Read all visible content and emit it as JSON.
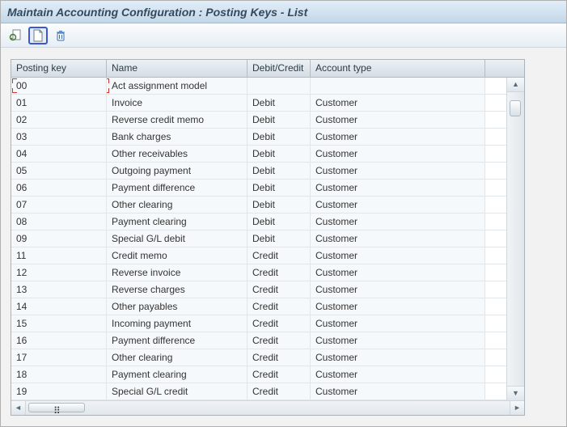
{
  "title": "Maintain Accounting Configuration : Posting Keys - List",
  "columns": {
    "key": "Posting key",
    "name": "Name",
    "dc": "Debit/Credit",
    "at": "Account type"
  },
  "rows": [
    {
      "key": "00",
      "name": "Act assignment model",
      "dc": "",
      "at": ""
    },
    {
      "key": "01",
      "name": "Invoice",
      "dc": "Debit",
      "at": "Customer"
    },
    {
      "key": "02",
      "name": "Reverse credit memo",
      "dc": "Debit",
      "at": "Customer"
    },
    {
      "key": "03",
      "name": "Bank charges",
      "dc": "Debit",
      "at": "Customer"
    },
    {
      "key": "04",
      "name": "Other receivables",
      "dc": "Debit",
      "at": "Customer"
    },
    {
      "key": "05",
      "name": "Outgoing payment",
      "dc": "Debit",
      "at": "Customer"
    },
    {
      "key": "06",
      "name": "Payment difference",
      "dc": "Debit",
      "at": "Customer"
    },
    {
      "key": "07",
      "name": "Other clearing",
      "dc": "Debit",
      "at": "Customer"
    },
    {
      "key": "08",
      "name": "Payment clearing",
      "dc": "Debit",
      "at": "Customer"
    },
    {
      "key": "09",
      "name": "Special G/L debit",
      "dc": "Debit",
      "at": "Customer"
    },
    {
      "key": "11",
      "name": "Credit memo",
      "dc": "Credit",
      "at": "Customer"
    },
    {
      "key": "12",
      "name": "Reverse invoice",
      "dc": "Credit",
      "at": "Customer"
    },
    {
      "key": "13",
      "name": "Reverse charges",
      "dc": "Credit",
      "at": "Customer"
    },
    {
      "key": "14",
      "name": "Other payables",
      "dc": "Credit",
      "at": "Customer"
    },
    {
      "key": "15",
      "name": "Incoming payment",
      "dc": "Credit",
      "at": "Customer"
    },
    {
      "key": "16",
      "name": "Payment difference",
      "dc": "Credit",
      "at": "Customer"
    },
    {
      "key": "17",
      "name": "Other clearing",
      "dc": "Credit",
      "at": "Customer"
    },
    {
      "key": "18",
      "name": "Payment clearing",
      "dc": "Credit",
      "at": "Customer"
    },
    {
      "key": "19",
      "name": "Special G/L credit",
      "dc": "Credit",
      "at": "Customer"
    }
  ]
}
